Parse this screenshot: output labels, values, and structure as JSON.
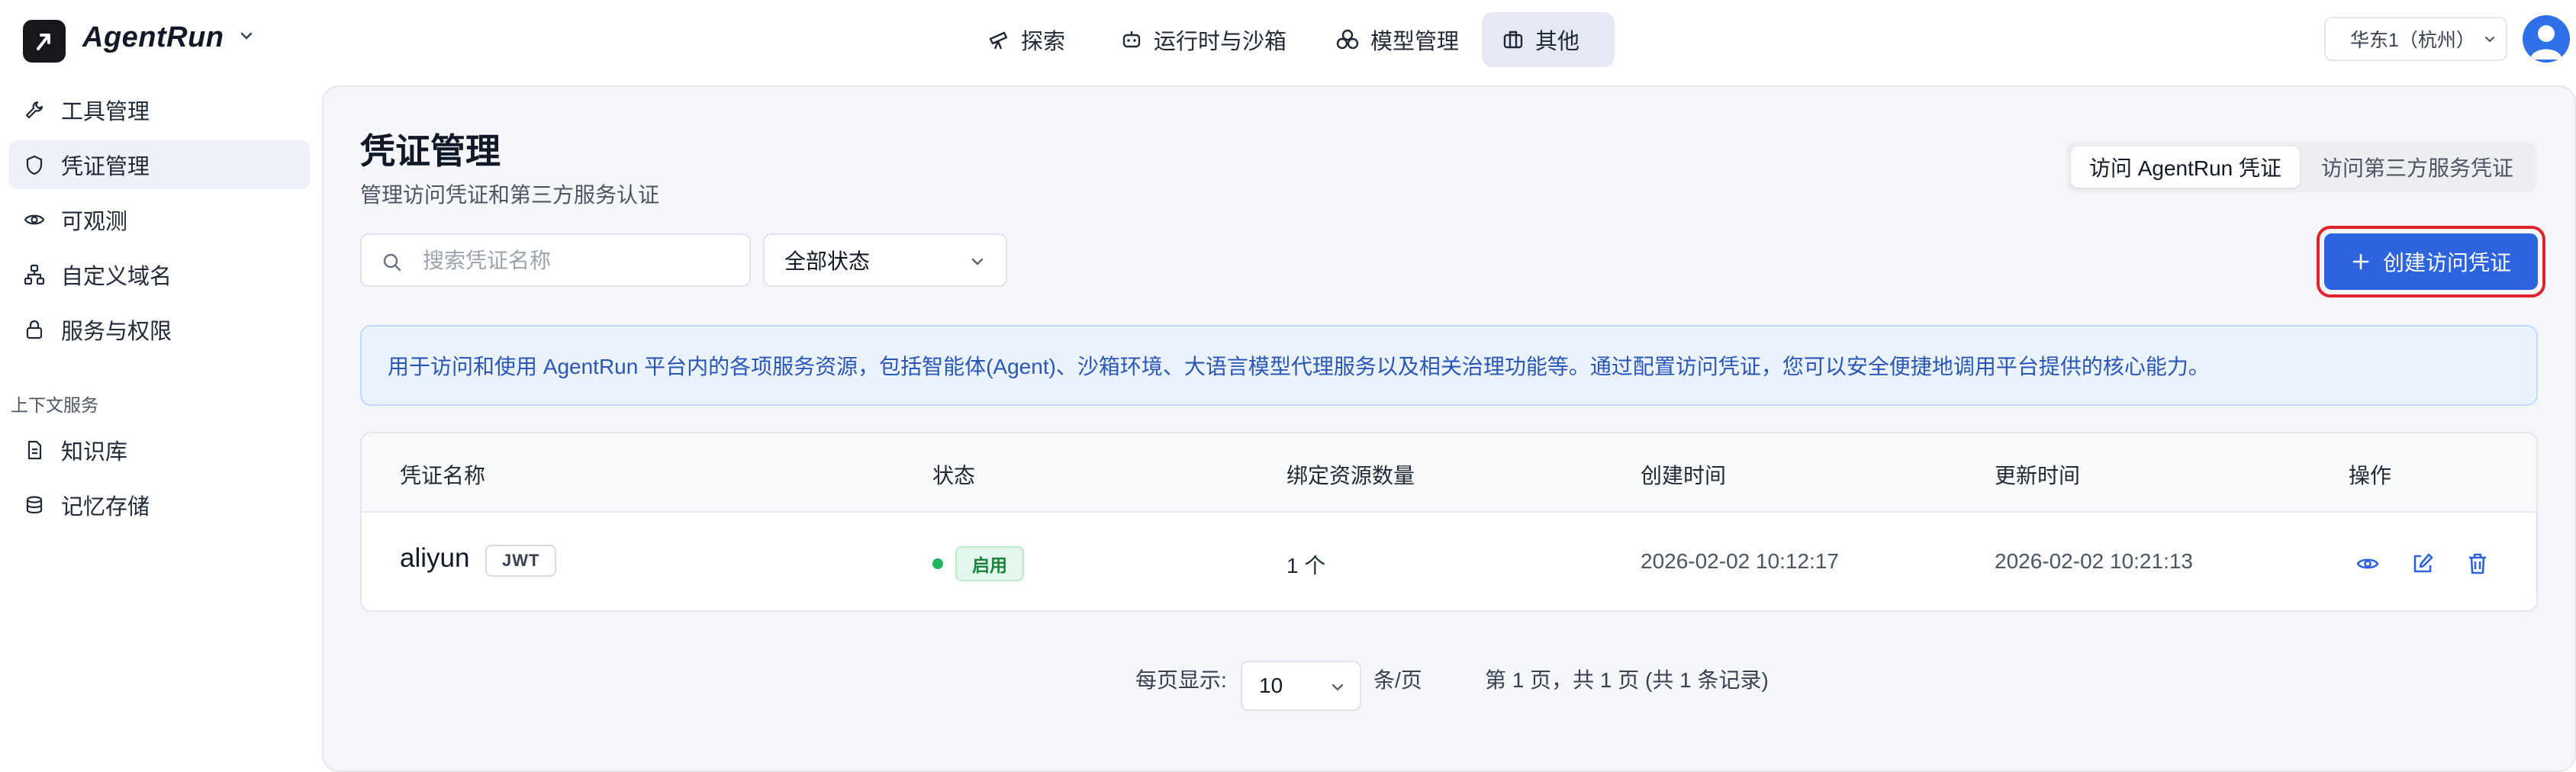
{
  "app": {
    "name": "AgentRun"
  },
  "nav": [
    {
      "label": "探索",
      "icon": "telescope-icon"
    },
    {
      "label": "运行时与沙箱",
      "icon": "robot-icon"
    },
    {
      "label": "模型管理",
      "icon": "cubes-icon"
    },
    {
      "label": "其他",
      "icon": "briefcase-icon",
      "active": true
    }
  ],
  "region": {
    "label": "华东1（杭州）"
  },
  "sidebar": {
    "items": [
      {
        "label": "工具管理",
        "icon": "wrench-icon"
      },
      {
        "label": "凭证管理",
        "icon": "shield-icon",
        "active": true
      },
      {
        "label": "可观测",
        "icon": "eye-icon"
      },
      {
        "label": "自定义域名",
        "icon": "sitemap-icon"
      },
      {
        "label": "服务与权限",
        "icon": "lock-icon"
      }
    ],
    "group_label": "上下文服务",
    "group_items": [
      {
        "label": "知识库",
        "icon": "document-icon"
      },
      {
        "label": "记忆存储",
        "icon": "database-icon"
      }
    ]
  },
  "page": {
    "title": "凭证管理",
    "subtitle": "管理访问凭证和第三方服务认证",
    "tabs": [
      "访问 AgentRun 凭证",
      "访问第三方服务凭证"
    ],
    "search_placeholder": "搜索凭证名称",
    "status_filter": "全部状态",
    "create_button": "创建访问凭证",
    "info": "用于访问和使用 AgentRun 平台内的各项服务资源，包括智能体(Agent)、沙箱环境、大语言模型代理服务以及相关治理功能等。通过配置访问凭证，您可以安全便捷地调用平台提供的核心能力。"
  },
  "table": {
    "columns": [
      "凭证名称",
      "状态",
      "绑定资源数量",
      "创建时间",
      "更新时间",
      "操作"
    ],
    "rows": [
      {
        "name": "aliyun",
        "type": "JWT",
        "status": "启用",
        "resources": "1 个",
        "created": "2026-02-02 10:12:17",
        "updated": "2026-02-02 10:21:13"
      }
    ]
  },
  "pagination": {
    "per_page_label": "每页显示:",
    "page_size": "10",
    "unit": "条/页",
    "summary": "第 1 页，共 1 页 (共 1 条记录)"
  },
  "colors": {
    "primary": "#2d63df",
    "highlight": "#e0242c",
    "success": "#22b35e"
  }
}
